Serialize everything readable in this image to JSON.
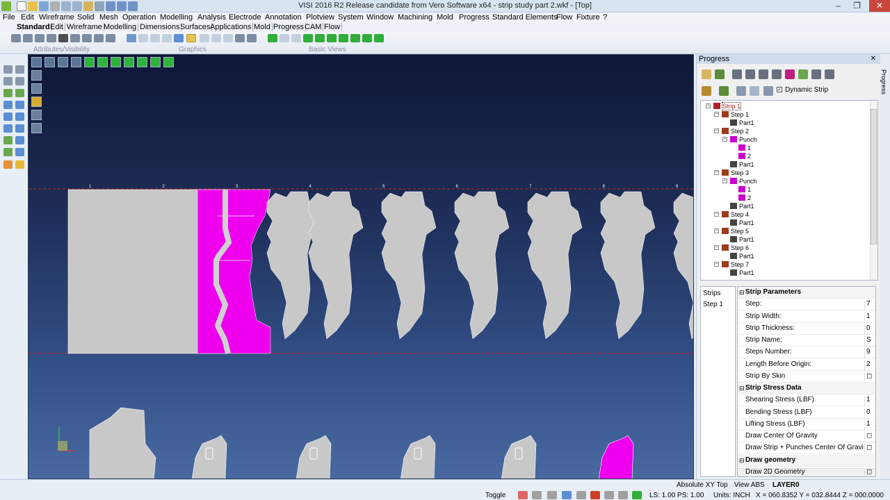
{
  "window": {
    "title": "VISI 2016 R2 Release candidate from Vero Software x64 - strip study part 2.wkf - [Top]",
    "controls": [
      "–",
      "❐",
      "✕"
    ]
  },
  "menu": [
    "File",
    "Edit",
    "Wireframe",
    "Solid",
    "Mesh",
    "Operation",
    "Modelling",
    "Analysis",
    "Electrode",
    "Annotation",
    "Plotview",
    "System",
    "Window",
    "Machining",
    "Mold",
    "Progress",
    "Standard Elements",
    "Flow",
    "Fixture",
    "?"
  ],
  "tabs": [
    "Standard",
    "Edit",
    "Wireframe",
    "Modelling",
    "Dimensions",
    "Surfaces",
    "Applications",
    "Mold",
    "Progress",
    "CAM",
    "Flow"
  ],
  "ribbon_groups": [
    "Attributes/Visibility",
    "Graphics",
    "Basic Views"
  ],
  "viewport": {
    "stations": [
      "1",
      "2",
      "3",
      "4",
      "5",
      "6",
      "7",
      "8",
      "9"
    ],
    "colors": {
      "part": "#c8c8c8",
      "punch": "#ee00ee",
      "guide": "#d21e1e"
    }
  },
  "panel": {
    "title": "Progress",
    "dynamic_strip_label": "Dynamic Strip",
    "tree": [
      {
        "label": "Strip 1",
        "level": 0,
        "icon": "strip"
      },
      {
        "label": "Step 1",
        "level": 1,
        "icon": "step"
      },
      {
        "label": "Part1",
        "level": 2,
        "icon": "part"
      },
      {
        "label": "Step 2",
        "level": 1,
        "icon": "step"
      },
      {
        "label": "Punch",
        "level": 2,
        "icon": "punch"
      },
      {
        "label": "1",
        "level": 3,
        "icon": "punch"
      },
      {
        "label": "2",
        "level": 3,
        "icon": "punch"
      },
      {
        "label": "Part1",
        "level": 2,
        "icon": "part"
      },
      {
        "label": "Step 3",
        "level": 1,
        "icon": "step"
      },
      {
        "label": "Punch",
        "level": 2,
        "icon": "punch"
      },
      {
        "label": "1",
        "level": 3,
        "icon": "punch"
      },
      {
        "label": "2",
        "level": 3,
        "icon": "punch"
      },
      {
        "label": "Part1",
        "level": 2,
        "icon": "part"
      },
      {
        "label": "Step 4",
        "level": 1,
        "icon": "step"
      },
      {
        "label": "Part1",
        "level": 2,
        "icon": "part"
      },
      {
        "label": "Step 5",
        "level": 1,
        "icon": "step"
      },
      {
        "label": "Part1",
        "level": 2,
        "icon": "part"
      },
      {
        "label": "Step 6",
        "level": 1,
        "icon": "step"
      },
      {
        "label": "Part1",
        "level": 2,
        "icon": "part"
      },
      {
        "label": "Step 7",
        "level": 1,
        "icon": "step"
      },
      {
        "label": "Part1",
        "level": 2,
        "icon": "part"
      }
    ],
    "strips_header": "Strips",
    "strips": [
      "Step 1"
    ],
    "properties": [
      {
        "type": "cat",
        "label": "Strip Parameters"
      },
      {
        "type": "row",
        "label": "Step:",
        "value": "7"
      },
      {
        "type": "row",
        "label": "Strip Width:",
        "value": "1"
      },
      {
        "type": "row",
        "label": "Strip Thickness:",
        "value": "0"
      },
      {
        "type": "row",
        "label": "Strip Name:",
        "value": "S"
      },
      {
        "type": "row",
        "label": "Steps Number:",
        "value": "9"
      },
      {
        "type": "row",
        "label": "Length Before Origin:",
        "value": "2"
      },
      {
        "type": "row",
        "label": "Strip By Skin",
        "value": "◻"
      },
      {
        "type": "cat",
        "label": "Strip Stress Data"
      },
      {
        "type": "row",
        "label": "Shearing Stress (LBF)",
        "value": "1"
      },
      {
        "type": "row",
        "label": "Bending Stress (LBF)",
        "value": "0"
      },
      {
        "type": "row",
        "label": "Lifting Stress (LBF)",
        "value": "1"
      },
      {
        "type": "row",
        "label": "Draw Center Of Gravity",
        "value": "◻"
      },
      {
        "type": "row",
        "label": "Draw Strip + Punches Center Of Gravi",
        "value": "◻"
      },
      {
        "type": "cat",
        "label": "Draw geometry"
      },
      {
        "type": "row",
        "label": "Draw 2D Geometry",
        "value": "◻"
      }
    ],
    "vertical_tab": "Progress"
  },
  "status": {
    "view": "Absolute XY Top",
    "view_abs": "View ABS",
    "layer": "LAYER0",
    "toggle": "Toggle",
    "ls": "LS: 1.00 PS: 1.00",
    "units": "Units: INCH",
    "coords": "X = 060.8352 Y = 032.8444 Z = 000.0000"
  }
}
